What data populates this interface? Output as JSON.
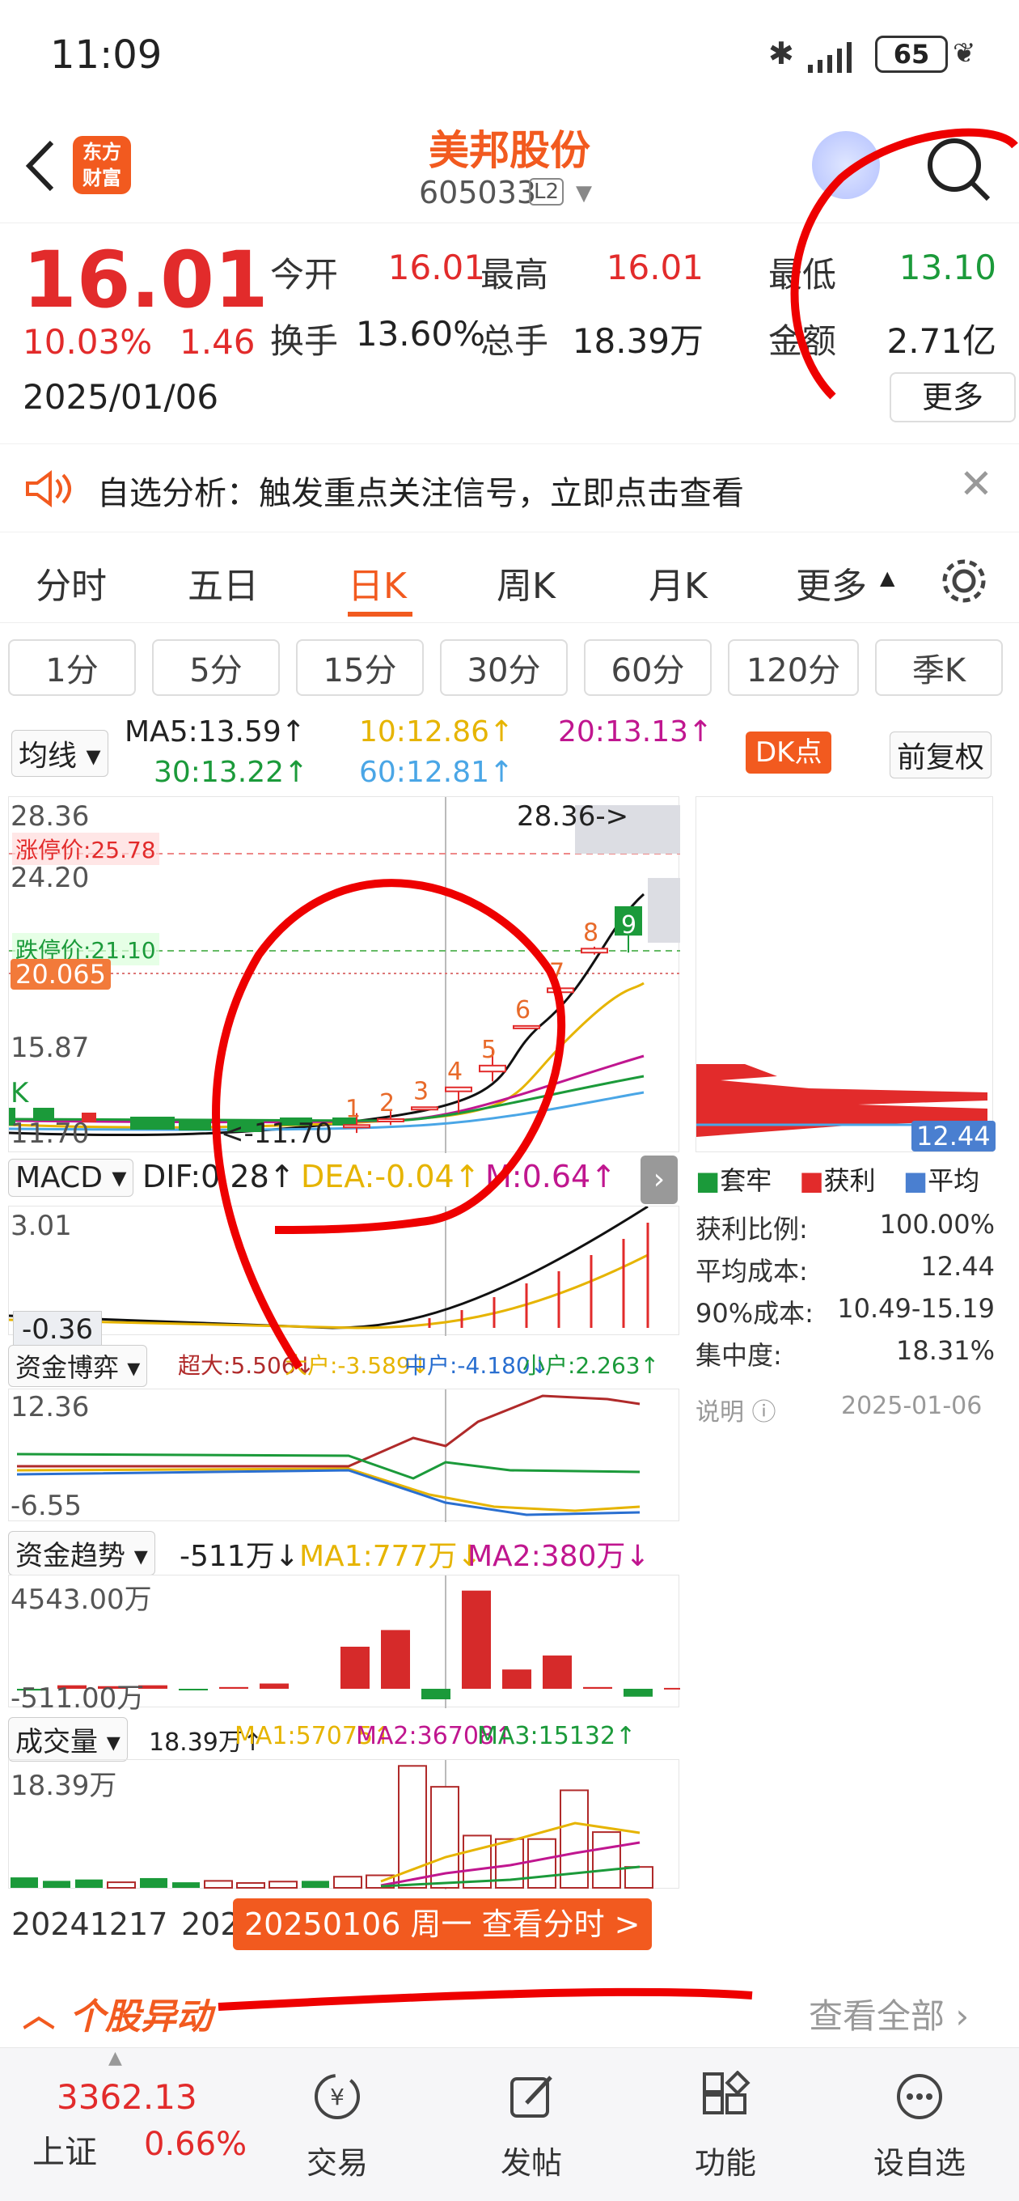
{
  "status": {
    "time": "11:09",
    "battery": "65"
  },
  "header": {
    "logo_line1": "东方",
    "logo_line2": "财富",
    "title": "美邦股份",
    "code": "605033",
    "badge": "L2"
  },
  "quote": {
    "price": "16.01",
    "pct": "10.03%",
    "change": "1.46",
    "date": "2025/01/06",
    "fields": [
      {
        "label": "今开",
        "value": "16.01",
        "color": "#e22b2b"
      },
      {
        "label": "最高",
        "value": "16.01",
        "color": "#e22b2b"
      },
      {
        "label": "最低",
        "value": "13.10",
        "color": "#1b9a3a"
      },
      {
        "label": "换手",
        "value": "13.60%",
        "color": "#222"
      },
      {
        "label": "总手",
        "value": "18.39万",
        "color": "#222"
      },
      {
        "label": "金额",
        "value": "2.71亿",
        "color": "#222"
      }
    ],
    "more": "更多"
  },
  "banner": {
    "text": "自选分析：触发重点关注信号，立即点击查看"
  },
  "tabs": [
    "分时",
    "五日",
    "日K",
    "周K",
    "月K",
    "更多"
  ],
  "active_tab": "日K",
  "periods": [
    "1分",
    "5分",
    "15分",
    "30分",
    "60分",
    "120分",
    "季K"
  ],
  "ma": {
    "selector": "均线",
    "ma5": "MA5:13.59↑",
    "ma10": "10:12.86↑",
    "ma20": "20:13.13↑",
    "ma30": "30:13.22↑",
    "ma60": "60:12.81↑",
    "dk": "DK点",
    "fq": "前复权"
  },
  "kchart": {
    "top": "28.36",
    "p2": "24.20",
    "p3": "20.065",
    "p4": "15.87",
    "p5": "11.70",
    "limit_up": "涨停价:25.78",
    "limit_down": "跌停价:21.10",
    "max_note": "28.36->",
    "min_note": "<-11.70",
    "k_label": "K",
    "candles": [
      {
        "label": "1",
        "open": 12.2,
        "close": 12.3,
        "high": 12.9,
        "low": 11.9
      },
      {
        "label": "2",
        "open": 12.6,
        "close": 12.5,
        "high": 13.0,
        "low": 12.3
      },
      {
        "label": "3",
        "open": 13.2,
        "close": 13.2,
        "high": 13.2,
        "low": 13.2
      },
      {
        "label": "4",
        "open": 14.0,
        "close": 14.2,
        "high": 14.2,
        "low": 12.9
      },
      {
        "label": "5",
        "open": 15.0,
        "close": 15.3,
        "high": 16.2,
        "low": 14.5
      },
      {
        "label": "6",
        "open": 17.2,
        "close": 17.3,
        "high": 17.3,
        "low": 17.2
      },
      {
        "label": "7",
        "open": 19.0,
        "close": 19.2,
        "high": 19.2,
        "low": 18.9
      },
      {
        "label": "8",
        "open": 21.0,
        "close": 21.2,
        "high": 21.3,
        "low": 20.9
      },
      {
        "label": "9",
        "open": 23.3,
        "close": 21.9,
        "high": 23.3,
        "low": 21.0
      }
    ]
  },
  "chips": {
    "value": "12.44",
    "legend": [
      "套牢",
      "获利",
      "平均"
    ],
    "rows": [
      {
        "k": "获利比例:",
        "v": "100.00%"
      },
      {
        "k": "平均成本:",
        "v": "12.44"
      },
      {
        "k": "90%成本:",
        "v": "10.49-15.19"
      },
      {
        "k": "集中度:",
        "v": "18.31%"
      }
    ],
    "note": "说明",
    "date": "2025-01-06"
  },
  "macd": {
    "selector": "MACD",
    "dif": "DIF:0.28↑",
    "dea": "DEA:-0.04↑",
    "m": "M:0.64↑",
    "top": "3.01",
    "bottom": "-0.36"
  },
  "fund": {
    "selector": "资金博弈",
    "super": "超大:5.506↓",
    "big": "大户:-3.589↓",
    "mid": "中户:-4.180↓",
    "small": "小户:2.263↑",
    "top": "12.36",
    "bottom": "-6.55"
  },
  "trend": {
    "selector": "资金趋势",
    "v": "-511万↓",
    "ma1": "MA1:777万↓",
    "ma2": "MA2:380万↓",
    "top": "4543.00万",
    "bottom": "-511.00万",
    "bars": [
      -20,
      40,
      30,
      40,
      -10,
      20,
      60,
      480,
      670,
      -120,
      1120,
      220,
      380,
      20,
      -90,
      10
    ]
  },
  "volume": {
    "selector": "成交量",
    "v": "18.39万↑",
    "ma1": "MA1:57075↑",
    "ma2": "MA2:36708↑",
    "ma3": "MA3:15132↑",
    "top": "18.39万",
    "bars": [
      15,
      10,
      12,
      8,
      14,
      8,
      10,
      7,
      9,
      10,
      16,
      18,
      175,
      145,
      75,
      70,
      70,
      140,
      80,
      30
    ],
    "colors": [
      "g",
      "g",
      "g",
      "r",
      "g",
      "g",
      "r",
      "r",
      "r",
      "g",
      "r",
      "r",
      "r",
      "r",
      "r",
      "r",
      "r",
      "r",
      "r",
      "r"
    ]
  },
  "dates": {
    "left": "20241217",
    "mid": "202",
    "pill": "20250106 周一 查看分时 >"
  },
  "movement": {
    "title": "个股异动",
    "all": "查看全部"
  },
  "bottom": {
    "index_value": "3362.13",
    "index_name": "上证",
    "index_pct": "0.66%",
    "items": [
      "交易",
      "发帖",
      "功能",
      "设自选"
    ]
  }
}
